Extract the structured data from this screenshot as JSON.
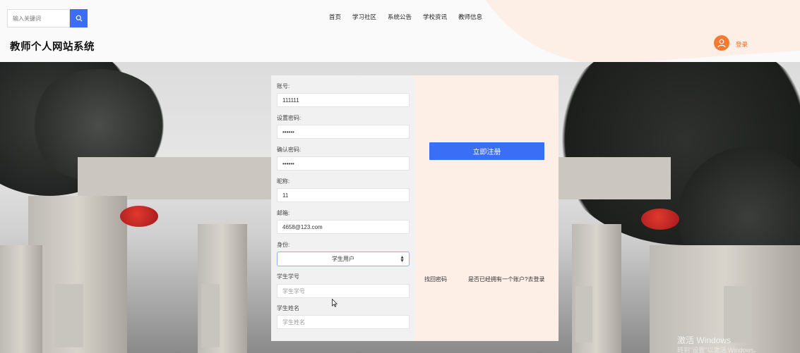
{
  "search": {
    "placeholder": "输入关键词"
  },
  "icons": {
    "search": "search-icon",
    "avatar": "user-avatar-icon",
    "cursor": "mouse-cursor-icon"
  },
  "nav": {
    "items": [
      "首页",
      "学习社区",
      "系统公告",
      "学校资讯",
      "教师信息"
    ]
  },
  "header": {
    "site_title": "教师个人网站系统",
    "login_label": "登录"
  },
  "colors": {
    "primary": "#3b6ef6",
    "accent": "#f47a2f",
    "panel_right": "#fdeee6",
    "panel_left": "#f1f1f1"
  },
  "form": {
    "account": {
      "label": "账号:",
      "value": "111111"
    },
    "password": {
      "label": "设置密码:",
      "value": "••••••"
    },
    "confirm_password": {
      "label": "确认密码:",
      "value": "••••••"
    },
    "nickname": {
      "label": "昵称:",
      "value": "11"
    },
    "email": {
      "label": "邮箱:",
      "value": "4658@123.com"
    },
    "identity": {
      "label": "身份:",
      "selected": "学生用户"
    },
    "student_id": {
      "label": "学生学号",
      "placeholder": "学生学号"
    },
    "student_name": {
      "label": "学生姓名",
      "placeholder": "学生姓名"
    },
    "register_label": "立即注册",
    "find_password_label": "找回密码",
    "goto_login_label": "是否已经拥有一个账户?去登录"
  },
  "watermark": {
    "line1": "激活 Windows",
    "line2": "转到\"设置\"以激活 Windows。"
  }
}
